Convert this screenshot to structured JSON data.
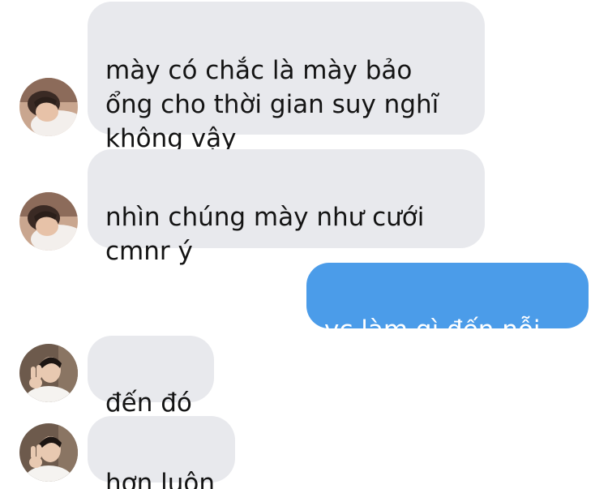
{
  "conversation": {
    "messages": [
      {
        "sender": "other",
        "avatar_icon": "person-lying-on-pillow-avatar",
        "text": "mày có chắc là mày bảo\nổng cho thời gian suy nghĩ\nkhông vậy"
      },
      {
        "sender": "other",
        "avatar_icon": "person-lying-on-pillow-avatar",
        "text": "nhìn chúng mày như cưới\ncmnr ý"
      },
      {
        "sender": "me",
        "text": "vc làm gì đến nỗi..."
      },
      {
        "sender": "other",
        "avatar_icon": "person-peace-sign-avatar",
        "text": "đến đó"
      },
      {
        "sender": "other",
        "avatar_icon": "person-peace-sign-avatar",
        "text": "hơn luôn"
      }
    ],
    "colors": {
      "incoming_bubble": "#e8e9ed",
      "outgoing_bubble": "#4b9ce9",
      "incoming_text": "#141414",
      "outgoing_text": "#ffffff"
    }
  }
}
